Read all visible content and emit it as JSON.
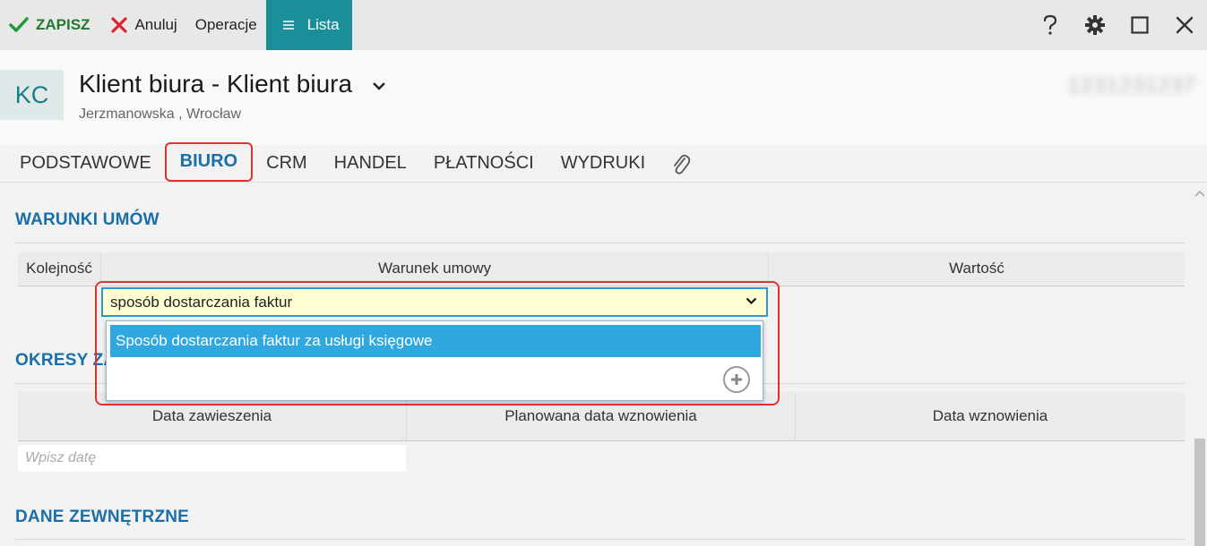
{
  "toolbar": {
    "save_label": "ZAPISZ",
    "cancel_label": "Anuluj",
    "operations_label": "Operacje",
    "list_label": "Lista"
  },
  "header": {
    "avatar_initials": "KC",
    "title": "Klient biura - Klient biura",
    "subtitle": "Jerzmanowska ,  Wrocław",
    "blurred_id": "1231231237"
  },
  "tabs": [
    {
      "label": "PODSTAWOWE"
    },
    {
      "label": "BIURO"
    },
    {
      "label": "CRM"
    },
    {
      "label": "HANDEL"
    },
    {
      "label": "PŁATNOŚCI"
    },
    {
      "label": "WYDRUKI"
    }
  ],
  "warunki": {
    "title": "WARUNKI UMÓW",
    "columns": [
      "Kolejność",
      "Warunek umowy",
      "Wartość"
    ],
    "combo_value": "sposób dostarczania faktur",
    "dropdown_option": "Sposób dostarczania faktur za usługi księgowe"
  },
  "okresy": {
    "title": "OKRESY ZA",
    "columns": [
      "Data zawieszenia",
      "Planowana data wznowienia",
      "Data wznowienia"
    ],
    "date_placeholder": "Wpisz datę"
  },
  "dane": {
    "title": "DANE ZEWNĘTRZNE"
  },
  "colors": {
    "accent": "#1a6fa8",
    "lista_bg": "#1a8f99",
    "highlight": "#2fa8e0",
    "save_green": "#1f7a30",
    "cancel_red": "#d8262c",
    "focus_red": "#e03030"
  }
}
